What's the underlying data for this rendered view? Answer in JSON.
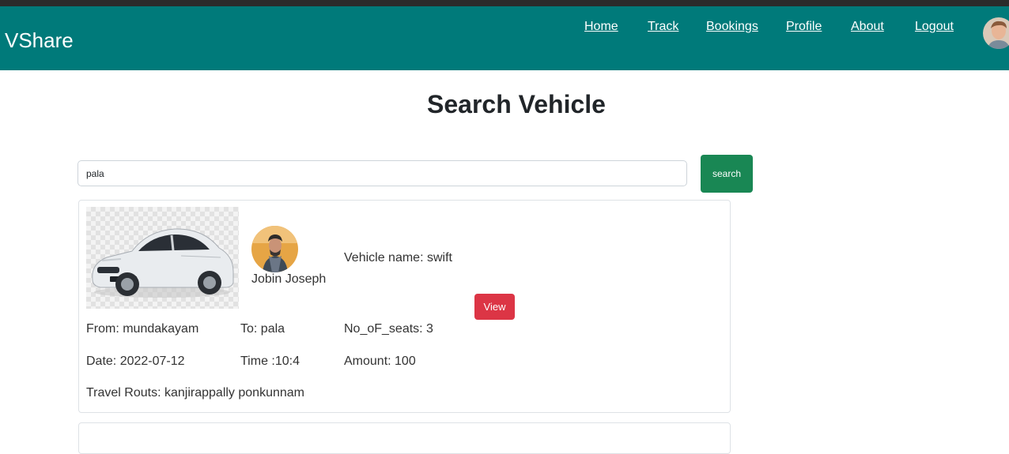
{
  "app": {
    "brand": "VShare"
  },
  "nav": {
    "items": [
      {
        "label": "Home"
      },
      {
        "label": "Track"
      },
      {
        "label": "Bookings"
      },
      {
        "label": "Profile"
      },
      {
        "label": "About"
      },
      {
        "label": "Logout"
      }
    ]
  },
  "page": {
    "title": "Search Vehicle"
  },
  "search": {
    "value": "pala",
    "button_label": "search"
  },
  "results": [
    {
      "owner_name": "Jobin Joseph",
      "vehicle_name": "Vehicle name: swift",
      "view_label": "View",
      "from": "From: mundakayam",
      "to": "To: pala",
      "seats": "No_oF_seats: 3",
      "date": "Date: 2022-07-12",
      "time": "Time :10:4",
      "amount": "Amount: 100",
      "routes": "Travel Routs: kanjirappally ponkunnam"
    }
  ],
  "colors": {
    "navbar": "#007a7a",
    "search_button": "#198754",
    "view_button": "#dc3545"
  }
}
